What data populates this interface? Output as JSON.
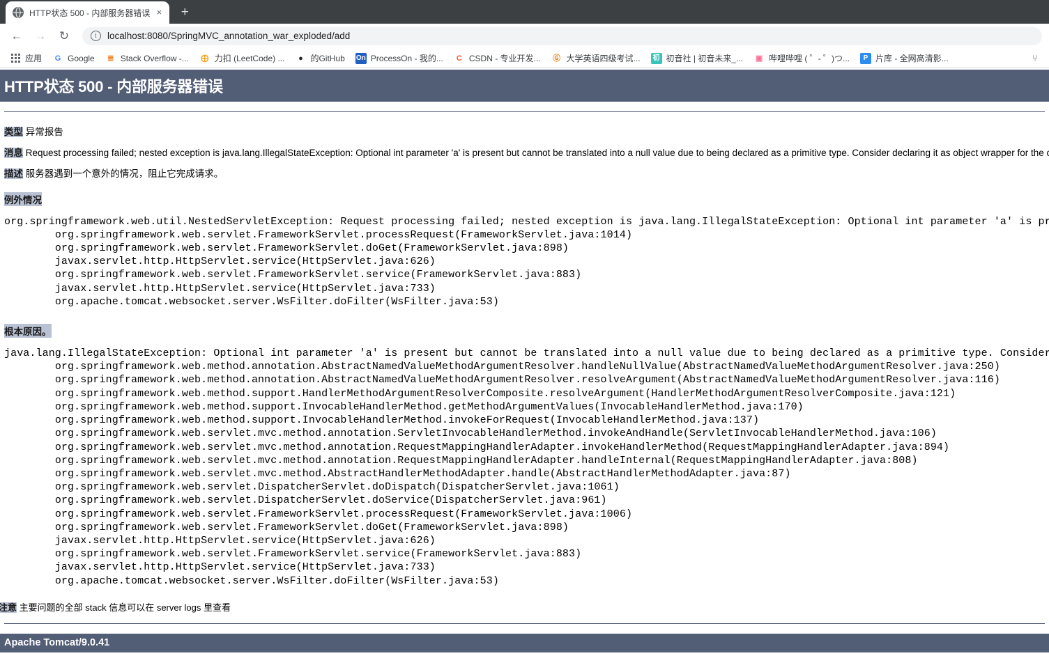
{
  "browser": {
    "tab": {
      "favicon": "globe-icon",
      "title": "HTTP状态 500 - 内部服务器错误",
      "close": "×"
    },
    "new_tab_label": "+",
    "nav": {
      "back": "←",
      "forward": "→",
      "reload": "↻"
    },
    "omnibox": {
      "info_glyph": "i",
      "url": "localhost:8080/SpringMVC_annotation_war_exploded/add"
    },
    "bookmarks": [
      {
        "icon": "apps-grid-icon",
        "icon_text": "",
        "label": "应用",
        "color": "#5f6368",
        "bg": ""
      },
      {
        "icon": "google-icon",
        "icon_text": "G",
        "label": "Google",
        "color": "#4285F4",
        "bg": ""
      },
      {
        "icon": "stackoverflow-icon",
        "icon_text": "≣",
        "label": "Stack Overflow -...",
        "color": "#F48024",
        "bg": ""
      },
      {
        "icon": "leetcode-icon",
        "icon_text": "⨁",
        "label": "力扣 (LeetCode) ...",
        "color": "#FFA116",
        "bg": ""
      },
      {
        "icon": "github-icon",
        "icon_text": "●",
        "label": "的GitHub",
        "color": "#24292e",
        "bg": ""
      },
      {
        "icon": "processon-icon",
        "icon_text": "On",
        "label": "ProcessOn - 我的...",
        "color": "#ffffff",
        "bg": "#1f5fbf"
      },
      {
        "icon": "csdn-icon",
        "icon_text": "C",
        "label": "CSDN - 专业开发...",
        "color": "#fc5531",
        "bg": ""
      },
      {
        "icon": "cet4-icon",
        "icon_text": "Ⓖ",
        "label": "大学英语四级考试...",
        "color": "#e8820c",
        "bg": ""
      },
      {
        "icon": "miku-icon",
        "icon_text": "初",
        "label": "初音社 | 初音未来_...",
        "color": "#ffffff",
        "bg": "#39c5bb"
      },
      {
        "icon": "bilibili-icon",
        "icon_text": "▣",
        "label": "哔哩哔哩 ( ゜- ゜)つ...",
        "color": "#fb7299",
        "bg": ""
      },
      {
        "icon": "pianku-icon",
        "icon_text": "P",
        "label": "片库 - 全网高清影...",
        "color": "#ffffff",
        "bg": "#2d8cf0"
      }
    ],
    "bookmarks_overflow_icon": "extension-icon",
    "bookmarks_overflow_glyph": "⑂"
  },
  "error_page": {
    "title": "HTTP状态 500 - 内部服务器错误",
    "type_label": "类型",
    "type_value": "异常报告",
    "message_label": "消息",
    "message_value": "Request processing failed; nested exception is java.lang.IllegalStateException: Optional int parameter 'a' is present but cannot be translated into a null value due to being declared as a primitive type. Consider declaring it as object wrapper for the corresponding primitive type.",
    "description_label": "描述",
    "description_value": "服务器遇到一个意外的情况，阻止它完成请求。",
    "exception_label": "例外情况",
    "exception_trace": "org.springframework.web.util.NestedServletException: Request processing failed; nested exception is java.lang.IllegalStateException: Optional int parameter 'a' is present but cannot be translated into a null value due to being declared as a primitive type. Consider declaring it as object wrapper for the corresponding primitive type.\n\torg.springframework.web.servlet.FrameworkServlet.processRequest(FrameworkServlet.java:1014)\n\torg.springframework.web.servlet.FrameworkServlet.doGet(FrameworkServlet.java:898)\n\tjavax.servlet.http.HttpServlet.service(HttpServlet.java:626)\n\torg.springframework.web.servlet.FrameworkServlet.service(FrameworkServlet.java:883)\n\tjavax.servlet.http.HttpServlet.service(HttpServlet.java:733)\n\torg.apache.tomcat.websocket.server.WsFilter.doFilter(WsFilter.java:53)",
    "root_cause_label": "根本原因。",
    "root_cause_trace": "java.lang.IllegalStateException: Optional int parameter 'a' is present but cannot be translated into a null value due to being declared as a primitive type. Consider de\n\torg.springframework.web.method.annotation.AbstractNamedValueMethodArgumentResolver.handleNullValue(AbstractNamedValueMethodArgumentResolver.java:250)\n\torg.springframework.web.method.annotation.AbstractNamedValueMethodArgumentResolver.resolveArgument(AbstractNamedValueMethodArgumentResolver.java:116)\n\torg.springframework.web.method.support.HandlerMethodArgumentResolverComposite.resolveArgument(HandlerMethodArgumentResolverComposite.java:121)\n\torg.springframework.web.method.support.InvocableHandlerMethod.getMethodArgumentValues(InvocableHandlerMethod.java:170)\n\torg.springframework.web.method.support.InvocableHandlerMethod.invokeForRequest(InvocableHandlerMethod.java:137)\n\torg.springframework.web.servlet.mvc.method.annotation.ServletInvocableHandlerMethod.invokeAndHandle(ServletInvocableHandlerMethod.java:106)\n\torg.springframework.web.servlet.mvc.method.annotation.RequestMappingHandlerAdapter.invokeHandlerMethod(RequestMappingHandlerAdapter.java:894)\n\torg.springframework.web.servlet.mvc.method.annotation.RequestMappingHandlerAdapter.handleInternal(RequestMappingHandlerAdapter.java:808)\n\torg.springframework.web.servlet.mvc.method.AbstractHandlerMethodAdapter.handle(AbstractHandlerMethodAdapter.java:87)\n\torg.springframework.web.servlet.DispatcherServlet.doDispatch(DispatcherServlet.java:1061)\n\torg.springframework.web.servlet.DispatcherServlet.doService(DispatcherServlet.java:961)\n\torg.springframework.web.servlet.FrameworkServlet.processRequest(FrameworkServlet.java:1006)\n\torg.springframework.web.servlet.FrameworkServlet.doGet(FrameworkServlet.java:898)\n\tjavax.servlet.http.HttpServlet.service(HttpServlet.java:626)\n\torg.springframework.web.servlet.FrameworkServlet.service(FrameworkServlet.java:883)\n\tjavax.servlet.http.HttpServlet.service(HttpServlet.java:733)\n\torg.apache.tomcat.websocket.server.WsFilter.doFilter(WsFilter.java:53)",
    "note_label": "注意",
    "note_value": "主要问题的全部 stack 信息可以在 server logs 里查看",
    "footer": "Apache Tomcat/9.0.41",
    "colors": {
      "header_bg": "#525D76",
      "highlight_bg": "#b8c2d4",
      "text": "#000000"
    }
  }
}
